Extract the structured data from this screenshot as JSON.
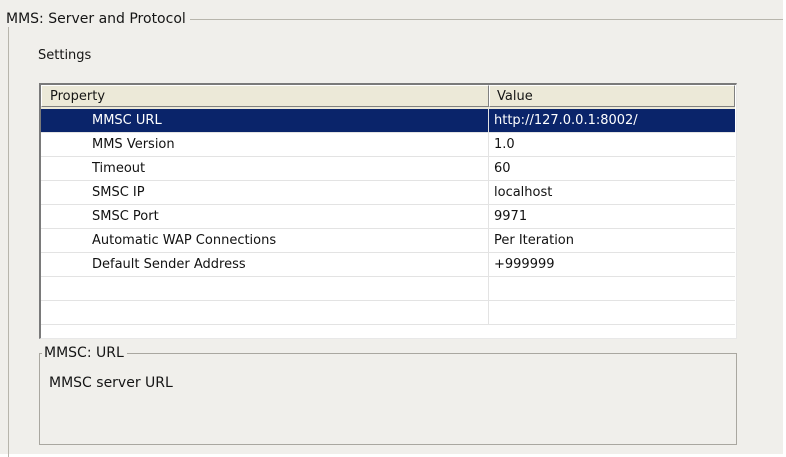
{
  "group": {
    "title": "MMS: Server and Protocol",
    "settings_label": "Settings"
  },
  "grid": {
    "columns": [
      "Property",
      "Value"
    ],
    "rows": [
      {
        "property": "MMSC URL",
        "value": "http://127.0.0.1:8002/",
        "selected": true
      },
      {
        "property": "MMS Version",
        "value": "1.0"
      },
      {
        "property": "Timeout",
        "value": "60"
      },
      {
        "property": "SMSC IP",
        "value": "localhost"
      },
      {
        "property": "SMSC Port",
        "value": "9971"
      },
      {
        "property": "Automatic WAP Connections",
        "value": "Per Iteration"
      },
      {
        "property": "Default Sender Address",
        "value": "+999999"
      },
      {
        "property": "",
        "value": ""
      },
      {
        "property": "",
        "value": ""
      }
    ]
  },
  "description": {
    "title": "MMSC: URL",
    "text": "MMSC server URL"
  },
  "colors": {
    "selection": "#0a246a",
    "panel": "#f0efeb",
    "header": "#ece9d8"
  }
}
